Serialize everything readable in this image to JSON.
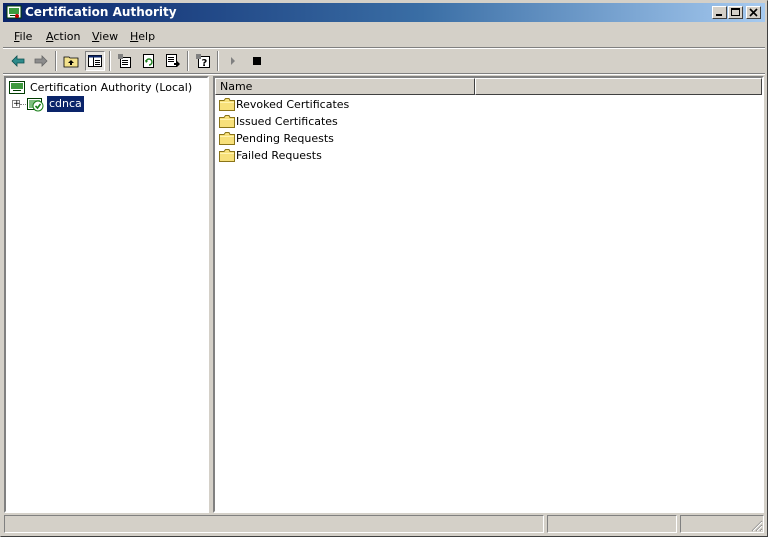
{
  "window": {
    "title": "Certification Authority"
  },
  "menu": [
    {
      "label": "File",
      "key": "F",
      "rest": "ile"
    },
    {
      "label": "Action",
      "key": "A",
      "rest": "ction"
    },
    {
      "label": "View",
      "key": "V",
      "rest": "iew"
    },
    {
      "label": "Help",
      "key": "H",
      "rest": "elp"
    }
  ],
  "toolbar": {
    "buttons": [
      "back-icon",
      "forward-icon",
      "up-one-level-icon",
      "show-hide-console-tree-icon",
      "properties-icon",
      "refresh-icon",
      "export-list-icon",
      "help-icon",
      "start-service-icon",
      "stop-service-icon"
    ]
  },
  "tree": {
    "root": "Certification Authority (Local)",
    "child": "cdnca"
  },
  "list": {
    "column": "Name",
    "items": [
      "Revoked Certificates",
      "Issued Certificates",
      "Pending Requests",
      "Failed Requests"
    ]
  },
  "colors": {
    "title_start": "#0a246a",
    "title_end": "#a6caf0",
    "selection": "#0a246a",
    "face": "#d4d0c8"
  }
}
